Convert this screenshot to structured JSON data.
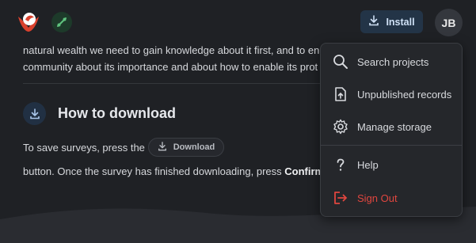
{
  "header": {
    "install_label": "Install",
    "avatar_initials": "JB"
  },
  "content": {
    "line1": "natural wealth we need to gain knowledge about it first, and to enc",
    "line2": "community about its importance and about how to enable its prot",
    "section_title": "How to download",
    "instr_before": "To save surveys, press the",
    "inline_download_label": "Download",
    "instr_after_normal": "button. Once the survey has finished downloading, press ",
    "instr_after_bold": "Confirm"
  },
  "menu": {
    "items": [
      {
        "label": "Search projects",
        "icon": "search-icon"
      },
      {
        "label": "Unpublished records",
        "icon": "file-upload-icon"
      },
      {
        "label": "Manage storage",
        "icon": "gear-icon"
      },
      {
        "label": "Help",
        "icon": "question-icon"
      },
      {
        "label": "Sign Out",
        "icon": "sign-out-icon"
      }
    ]
  },
  "colors": {
    "background": "#1f2125",
    "accent_blue": "#233447",
    "sign_out_red": "#e0463f",
    "sync_green": "#1d3a2a"
  }
}
